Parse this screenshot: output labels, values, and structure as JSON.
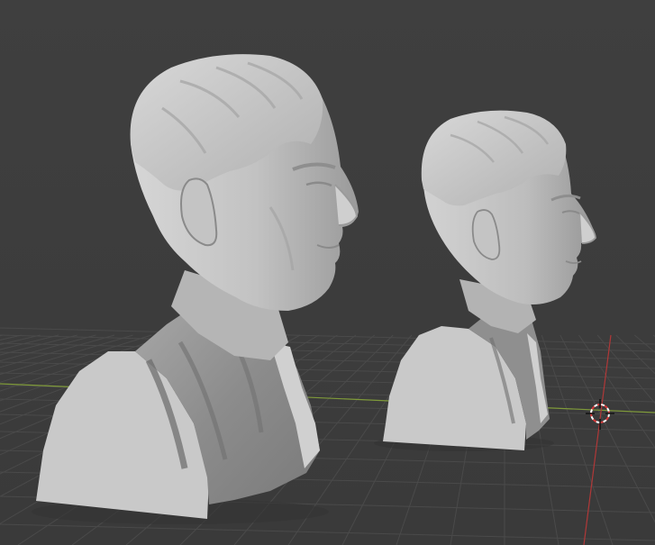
{
  "viewport": {
    "background_color": "#3d3d3d",
    "grid_line_color": "#4a4a4a",
    "x_axis_color": "#7f9a3a",
    "y_axis_color": "#b03838",
    "cursor_colors": [
      "#d83a3a",
      "#ffffff"
    ]
  },
  "objects": [
    {
      "name": "bust-large",
      "material_color": "#b8b8b8",
      "description_icon": "mesh-object"
    },
    {
      "name": "bust-small",
      "material_color": "#b8b8b8",
      "description_icon": "mesh-object"
    }
  ],
  "icons": {
    "cursor": "3d-cursor-icon"
  }
}
